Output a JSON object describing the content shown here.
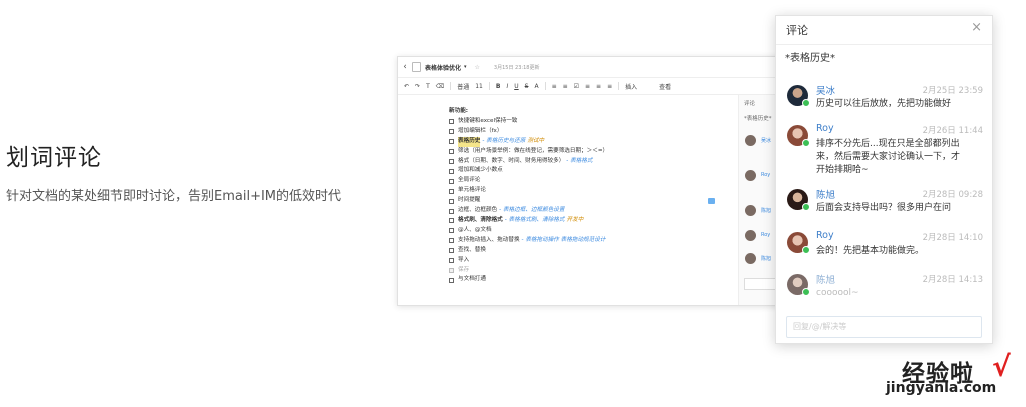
{
  "hero": {
    "title": "划词评论",
    "subtitle": "针对文档的某处细节即时讨论，告别Email+IM的低效时代"
  },
  "editor": {
    "back": "‹",
    "doc_title": "表格体验优化",
    "caret": "▾",
    "star": "☆",
    "updated": "3月15日 23:18更新",
    "toolbar": [
      "↶",
      "↷",
      "T",
      "⌫",
      "普通",
      "11",
      "B",
      "I",
      "U",
      "S",
      "A",
      "≡",
      "≡",
      "☑",
      "≡",
      "≡",
      "≡",
      "插入",
      "查看"
    ],
    "tasks": [
      {
        "text": "新功能:",
        "header": true
      },
      {
        "text": "快捷键和excel保持一致"
      },
      {
        "text": "增加编辑栏（fx）"
      },
      {
        "text": "表格历史",
        "highlight": true,
        "ann": "- 表格历史与还原",
        "tag": "测试中"
      },
      {
        "text": "筛选（用户场景举例：做在线登记，需要筛选日期；＞＜=）"
      },
      {
        "text": "格式（日期、数字、时间、财务用得较多）",
        "ann": "- 表格格式"
      },
      {
        "text": "增加和减少小数点"
      },
      {
        "text": "全局评论"
      },
      {
        "text": "单元格评论"
      },
      {
        "text": "时间提醒"
      },
      {
        "text": "边框、边框颜色",
        "ann": "- 表格边框、边框颜色设置"
      },
      {
        "text": "格式刷、清除格式",
        "bold": true,
        "ann": "- 表格格式刷、清除格式",
        "tag": "开发中"
      },
      {
        "text": "@人、@文档"
      },
      {
        "text": "支持拖动插入、拖动替换",
        "ann": "- 表格拖动操作 表格拖动规范设计"
      },
      {
        "text": "查找、替换"
      },
      {
        "text": "导入"
      },
      {
        "text": "保存",
        "done": true
      },
      {
        "text": "与文档打通"
      }
    ],
    "side": {
      "head": "评论",
      "hist": "*表格历史*",
      "minis": [
        "吴冰",
        "Roy",
        "陈旭",
        "Roy",
        "陈旭"
      ]
    }
  },
  "panel": {
    "title": "评论",
    "close": "×",
    "hist": "*表格历史*",
    "comments": [
      {
        "name": "吴冰",
        "date": "2月25日 23:59",
        "text": "历史可以往后放放，先把功能做好"
      },
      {
        "name": "Roy",
        "date": "2月26日 11:44",
        "text": "排序不分先后...现在只是全部都列出来，然后需要大家讨论确认一下，才开始排期哈~"
      },
      {
        "name": "陈旭",
        "date": "2月28日 09:28",
        "text": "后面会支持导出吗？很多用户在问"
      },
      {
        "name": "Roy",
        "date": "2月28日 14:10",
        "text": "会的！先把基本功能做完。"
      },
      {
        "name": "陈旭",
        "date": "2月28日 14:13",
        "text": "coooool~"
      }
    ],
    "reply_placeholder": "回复/@/解决等"
  },
  "watermark": {
    "main": "经验啦",
    "check": "√",
    "url": "jingyanla.com"
  }
}
